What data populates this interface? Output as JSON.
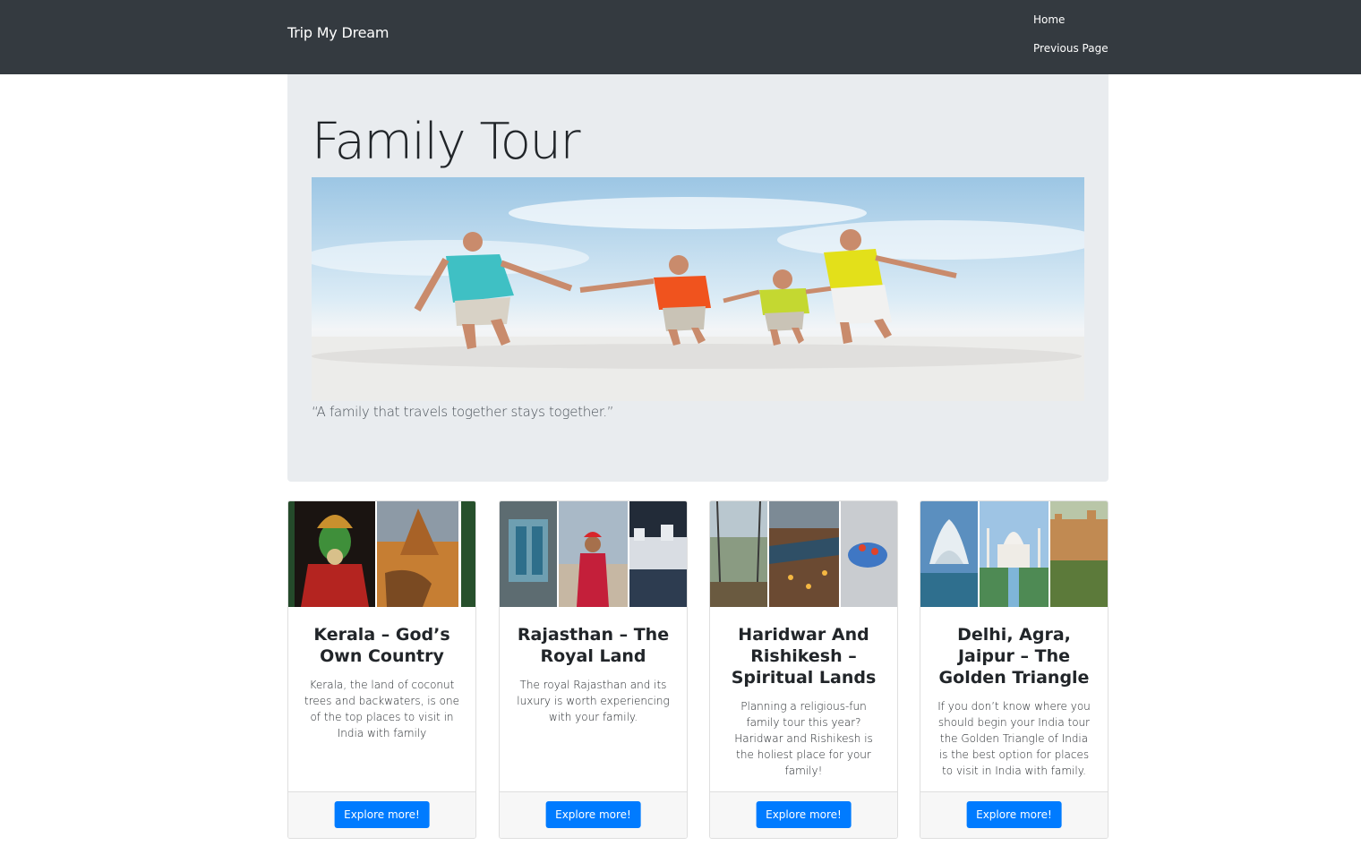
{
  "navbar": {
    "brand": "Trip My Dream",
    "links": [
      "Home",
      "Previous Page"
    ],
    "background": "#343a40"
  },
  "hero": {
    "title": "Family Tour",
    "quote": "“A family that travels together stays together.”",
    "image_icon": "family-beach-photo",
    "background": "#e9ecef"
  },
  "cards": [
    {
      "title": "Kerala – God’s Own Country",
      "text": "Kerala, the land of coconut trees and backwaters, is one of the top places to visit in India with family",
      "button": "Explore more!",
      "image_icon": "kerala-collage-photo"
    },
    {
      "title": "Rajasthan – The Royal Land",
      "text": "The royal Rajasthan and its luxury is worth experiencing with your family.",
      "button": "Explore more!",
      "image_icon": "rajasthan-collage-photo"
    },
    {
      "title": "Haridwar And Rishikesh – Spiritual Lands",
      "text": "Planning a religious-fun family tour this year? Haridwar and Rishikesh is the holiest place for your family!",
      "button": "Explore more!",
      "image_icon": "haridwar-collage-photo"
    },
    {
      "title": "Delhi, Agra, Jaipur – The Golden Triangle",
      "text": "If you don’t know where you should begin your India tour the Golden Triangle of India is the best option for places to visit in India with family.",
      "button": "Explore more!",
      "image_icon": "golden-triangle-collage-photo"
    }
  ],
  "colors": {
    "primary_button": "#007bff",
    "card_footer": "#f7f7f7"
  }
}
